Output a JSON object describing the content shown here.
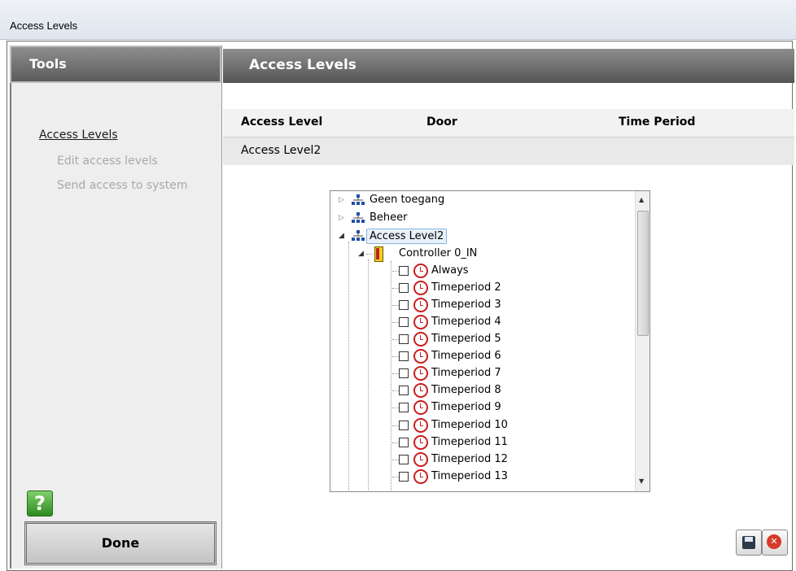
{
  "window": {
    "title": "Access Levels"
  },
  "tools": {
    "header": "Tools",
    "links": {
      "access_levels": "Access Levels"
    },
    "sub_items": [
      "Edit access levels",
      "Send access to system"
    ],
    "help_label": "?",
    "done_label": "Done"
  },
  "content": {
    "header": "Access Levels",
    "columns": [
      "Access Level",
      "Door",
      "Time Period"
    ],
    "selected_row": "Access Level2"
  },
  "tree": {
    "nodes": [
      "Geen toegang",
      "Beheer",
      "Access Level2"
    ],
    "controller": "Controller 0_IN",
    "time_periods": [
      "Always",
      "Timeperiod 2",
      "Timeperiod 3",
      "Timeperiod 4",
      "Timeperiod 5",
      "Timeperiod 6",
      "Timeperiod 7",
      "Timeperiod 8",
      "Timeperiod 9",
      "Timeperiod 10",
      "Timeperiod 11",
      "Timeperiod 12",
      "Timeperiod 13"
    ]
  },
  "colors": {
    "header_gradient_top": "#8d8d8d",
    "header_gradient_bottom": "#555555",
    "help_green": "#2e8b1f",
    "clock_red": "#c71e1e",
    "cancel_red": "#d63b2b"
  }
}
